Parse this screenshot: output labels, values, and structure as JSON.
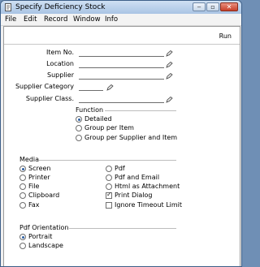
{
  "window": {
    "title": "Specify Deficiency Stock",
    "minimize": "‒",
    "maximize": "▫",
    "close": "✕"
  },
  "menu": [
    "File",
    "Edit",
    "Record",
    "Window",
    "Info"
  ],
  "toolbar": {
    "run_label": "Run"
  },
  "fields": [
    {
      "label": "Item No.",
      "value": ""
    },
    {
      "label": "Location",
      "value": ""
    },
    {
      "label": "Supplier",
      "value": ""
    },
    {
      "label": "Supplier Category",
      "value": ""
    },
    {
      "label": "Supplier Class.",
      "value": ""
    }
  ],
  "function": {
    "title": "Function",
    "options": [
      {
        "label": "Detailed",
        "selected": true
      },
      {
        "label": "Group per Item",
        "selected": false
      },
      {
        "label": "Group per Supplier and Item",
        "selected": false
      }
    ]
  },
  "media": {
    "title": "Media",
    "left": [
      {
        "label": "Screen",
        "selected": true
      },
      {
        "label": "Printer",
        "selected": false
      },
      {
        "label": "File",
        "selected": false
      },
      {
        "label": "Clipboard",
        "selected": false
      },
      {
        "label": "Fax",
        "selected": false
      }
    ],
    "right": [
      {
        "label": "Pdf",
        "type": "radio",
        "selected": false
      },
      {
        "label": "Pdf and Email",
        "type": "radio",
        "selected": false
      },
      {
        "label": "Html as Attachment",
        "type": "radio",
        "selected": false
      },
      {
        "label": "Print Dialog",
        "type": "checkbox",
        "checked": true
      },
      {
        "label": "Ignore Timeout Limit",
        "type": "checkbox",
        "checked": false
      }
    ]
  },
  "pdf_orientation": {
    "title": "Pdf Orientation",
    "options": [
      {
        "label": "Portrait",
        "selected": true
      },
      {
        "label": "Landscape",
        "selected": false
      }
    ]
  },
  "check_glyph": "✓"
}
